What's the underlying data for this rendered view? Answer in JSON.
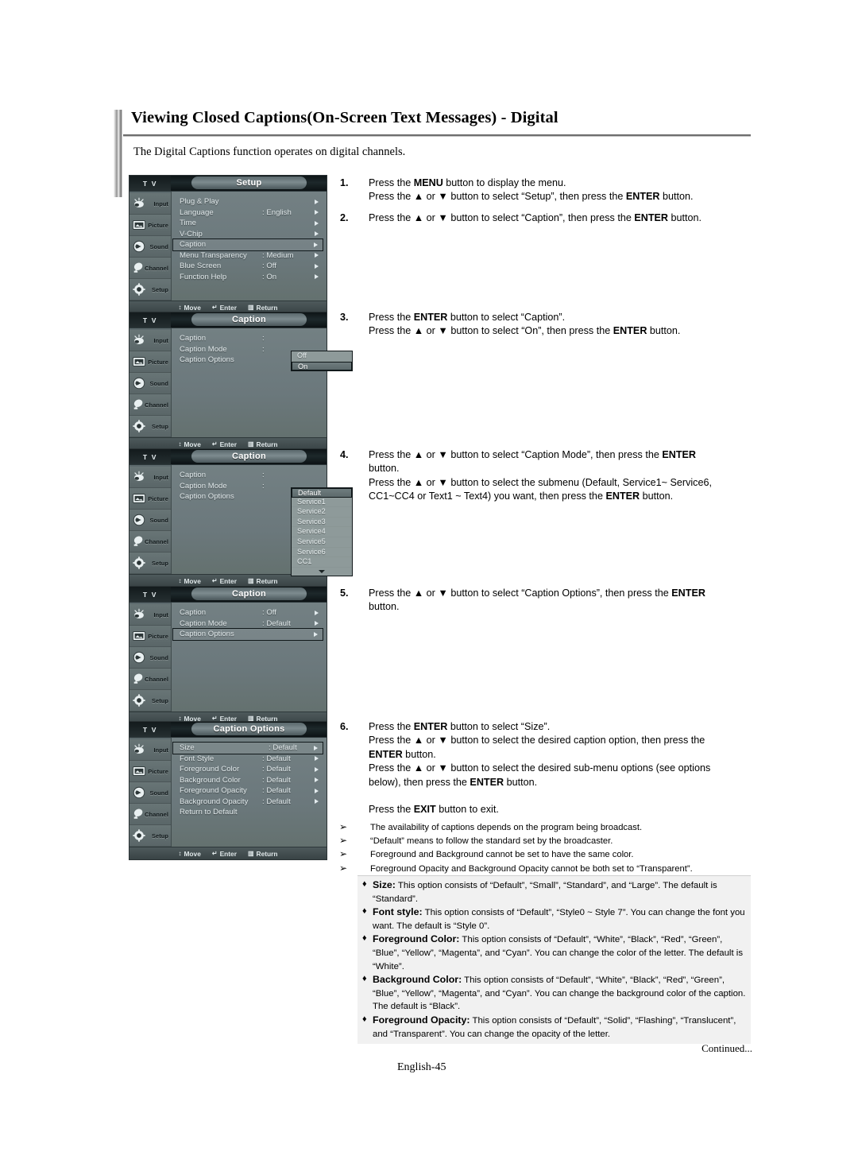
{
  "page": {
    "title": "Viewing Closed Captions(On-Screen Text Messages) - Digital",
    "intro": "The Digital Captions function operates on digital channels.",
    "continued": "Continued...",
    "page_number": "English-45"
  },
  "osd_common": {
    "tv_label": "T V",
    "sidebar": [
      {
        "label": "Input",
        "icon": "input-icon"
      },
      {
        "label": "Picture",
        "icon": "picture-icon"
      },
      {
        "label": "Sound",
        "icon": "sound-icon"
      },
      {
        "label": "Channel",
        "icon": "channel-icon"
      },
      {
        "label": "Setup",
        "icon": "setup-icon"
      }
    ],
    "footer": {
      "move": "Move",
      "enter": "Enter",
      "return": "Return"
    }
  },
  "menus": [
    {
      "id": "setup-menu",
      "title": "Setup",
      "rows": [
        {
          "label": "Plug & Play",
          "value": "",
          "arrow": true,
          "selected": false
        },
        {
          "label": "Language",
          "value": ": English",
          "arrow": true,
          "selected": false
        },
        {
          "label": "Time",
          "value": "",
          "arrow": true,
          "selected": false
        },
        {
          "label": "V-Chip",
          "value": "",
          "arrow": true,
          "selected": false
        },
        {
          "label": "Caption",
          "value": "",
          "arrow": true,
          "selected": true
        },
        {
          "label": "Menu Transparency",
          "value": ": Medium",
          "arrow": true,
          "selected": false
        },
        {
          "label": "Blue Screen",
          "value": ": Off",
          "arrow": true,
          "selected": false
        },
        {
          "label": "Function Help",
          "value": ": On",
          "arrow": true,
          "selected": false
        }
      ],
      "popup": null
    },
    {
      "id": "caption-onoff-menu",
      "title": "Caption",
      "rows": [
        {
          "label": "Caption",
          "value": ":",
          "arrow": false,
          "selected": false
        },
        {
          "label": "Caption Mode",
          "value": ":",
          "arrow": false,
          "selected": false
        },
        {
          "label": "Caption Options",
          "value": "",
          "arrow": false,
          "selected": false
        }
      ],
      "popup": {
        "items": [
          "Off",
          "On"
        ],
        "highlighted_index": 1,
        "more": false
      }
    },
    {
      "id": "caption-mode-menu",
      "title": "Caption",
      "rows": [
        {
          "label": "Caption",
          "value": ":",
          "arrow": false,
          "selected": false
        },
        {
          "label": "Caption Mode",
          "value": ":",
          "arrow": false,
          "selected": false
        },
        {
          "label": "Caption Options",
          "value": "",
          "arrow": false,
          "selected": false
        }
      ],
      "popup": {
        "items": [
          "Default",
          "Service1",
          "Service2",
          "Service3",
          "Service4",
          "Service5",
          "Service6",
          "CC1"
        ],
        "highlighted_index": 0,
        "more": true
      }
    },
    {
      "id": "caption-options-select-menu",
      "title": "Caption",
      "rows": [
        {
          "label": "Caption",
          "value": ": Off",
          "arrow": true,
          "selected": false
        },
        {
          "label": "Caption Mode",
          "value": ": Default",
          "arrow": true,
          "selected": false
        },
        {
          "label": "Caption Options",
          "value": "",
          "arrow": true,
          "selected": true
        }
      ],
      "popup": null
    },
    {
      "id": "caption-options-menu",
      "title": "Caption Options",
      "rows": [
        {
          "label": "Size",
          "value": ": Default",
          "arrow": true,
          "selected": true
        },
        {
          "label": "Font Style",
          "value": ": Default",
          "arrow": true,
          "selected": false
        },
        {
          "label": "Foreground Color",
          "value": ": Default",
          "arrow": true,
          "selected": false
        },
        {
          "label": "Background Color",
          "value": ": Default",
          "arrow": true,
          "selected": false
        },
        {
          "label": "Foreground Opacity",
          "value": ": Default",
          "arrow": true,
          "selected": false
        },
        {
          "label": "Background Opacity",
          "value": ": Default",
          "arrow": true,
          "selected": false
        },
        {
          "label": "Return to Default",
          "value": "",
          "arrow": false,
          "selected": false
        }
      ],
      "popup": null
    }
  ],
  "steps": [
    {
      "number": "1.",
      "lines": [
        "Press the <b>MENU</b> button to display the menu.",
        "Press the ▲ or ▼ button to select “Setup”, then press the <b>ENTER</b> button."
      ]
    },
    {
      "number": "2.",
      "lines": [
        "Press the ▲ or ▼ button to select “Caption”, then press the <b>ENTER</b> button."
      ]
    },
    {
      "number": "3.",
      "lines": [
        "Press the <b>ENTER</b> button to select “Caption”.",
        "Press the ▲ or ▼ button to select “On”, then press the <b>ENTER</b> button."
      ]
    },
    {
      "number": "4.",
      "lines": [
        "Press the ▲ or ▼ button to select “Caption Mode”, then press the <b>ENTER</b>",
        "button.",
        "Press the ▲ or ▼ button to select the submenu (Default, Service1~ Service6,",
        "CC1~CC4 or Text1 ~ Text4) you want, then press the <b>ENTER</b> button."
      ]
    },
    {
      "number": "5.",
      "lines": [
        "Press the ▲ or ▼ button to select “Caption Options”, then press the <b>ENTER</b>",
        "button."
      ]
    },
    {
      "number": "6.",
      "lines": [
        "Press the <b>ENTER</b> button to select “Size”.",
        "Press the ▲ or ▼ button to select the desired caption option, then press the",
        "<b>ENTER</b> button.",
        "Press the ▲ or ▼ button to select the desired sub-menu options (see options",
        "below), then press the <b>ENTER</b> button.",
        "&nbsp;",
        "Press the <b>EXIT</b> button to exit."
      ]
    }
  ],
  "notes": [
    "The availability of captions depends on the program being broadcast.",
    "“Default” means to follow the standard set by the broadcaster.",
    "Foreground and Background cannot be set to have the same color.",
    "Foreground Opacity and Background Opacity cannot be both set to “Transparent”."
  ],
  "options": [
    {
      "name": "Size:",
      "body": " This option consists of “Default”, “Small”, “Standard”, and “Large”. The default is “Standard”."
    },
    {
      "name": "Font style:",
      "body": " This option consists of “Default”, “Style0 ~ Style 7”. You can change the font you want. The default is “Style 0”."
    },
    {
      "name": "Foreground Color:",
      "body": " This option consists of “Default”, “White”, “Black”, “Red”, “Green”, “Blue”, “Yellow”, “Magenta”, and “Cyan”. You can change the color of the letter. The default is “White”."
    },
    {
      "name": "Background Color:",
      "body": " This option consists of “Default”, “White”, “Black”, “Red”, “Green”, “Blue”, “Yellow”, “Magenta”, and “Cyan”. You can change the background color of the caption. The default is “Black”."
    },
    {
      "name": "Foreground Opacity:",
      "body": " This option consists of “Default”, “Solid”, “Flashing”, “Translucent”, and “Transparent”. You can change the opacity of the letter."
    }
  ],
  "colors": {
    "osd_background": "#6c7a7e",
    "osd_header": "#101819",
    "osd_text": "#e2eaec",
    "note_box": "#f1f1f1"
  }
}
